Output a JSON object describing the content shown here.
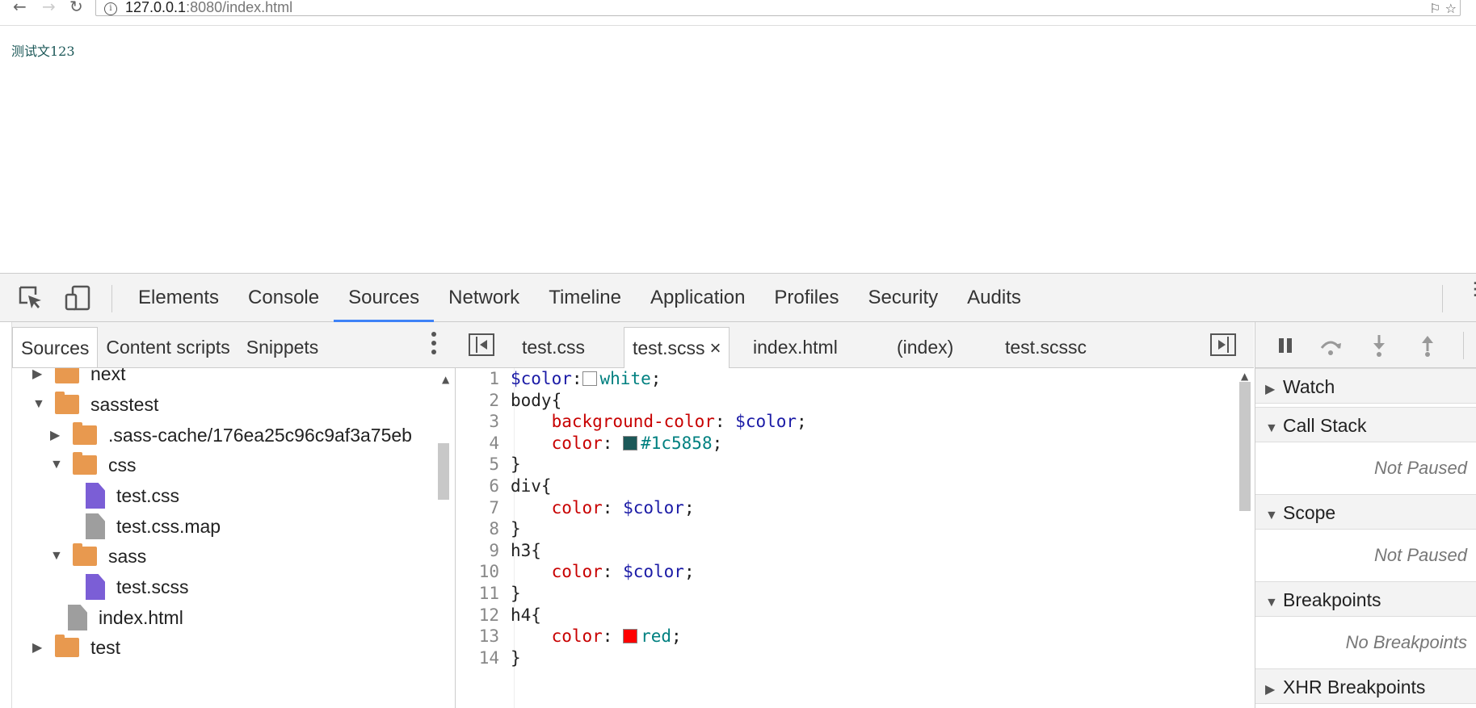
{
  "browser": {
    "url_host": "127.0.0.1",
    "url_rest": ":8080/index.html"
  },
  "page": {
    "text": "测试文123"
  },
  "devtools": {
    "main_tabs": [
      "Elements",
      "Console",
      "Sources",
      "Network",
      "Timeline",
      "Application",
      "Profiles",
      "Security",
      "Audits"
    ],
    "active_main_tab": "Sources",
    "navigator": {
      "tabs": [
        "Sources",
        "Content scripts",
        "Snippets"
      ],
      "active_tab": "Sources",
      "tree": [
        {
          "label": "next",
          "type": "folder",
          "expanded": false,
          "depth": 0
        },
        {
          "label": "sasstest",
          "type": "folder",
          "expanded": true,
          "depth": 0
        },
        {
          "label": ".sass-cache/176ea25c96c9af3a75eb",
          "type": "folder",
          "expanded": false,
          "depth": 1
        },
        {
          "label": "css",
          "type": "folder",
          "expanded": true,
          "depth": 1
        },
        {
          "label": "test.css",
          "type": "file-css",
          "depth": 2
        },
        {
          "label": "test.css.map",
          "type": "file",
          "depth": 2
        },
        {
          "label": "sass",
          "type": "folder",
          "expanded": true,
          "depth": 1
        },
        {
          "label": "test.scss",
          "type": "file-css",
          "depth": 2
        },
        {
          "label": "index.html",
          "type": "file",
          "depth": 1
        },
        {
          "label": "test",
          "type": "folder",
          "expanded": false,
          "depth": 0
        }
      ]
    },
    "editor": {
      "tabs": [
        "test.css",
        "test.scss",
        "index.html",
        "(index)",
        "test.scssc"
      ],
      "active_tab": "test.scss",
      "close_glyph": "×",
      "lines": [
        {
          "n": "1",
          "tokens": [
            [
              "var",
              "$color"
            ],
            [
              "plain",
              ":"
            ],
            [
              "swatch",
              "#ffffff"
            ],
            [
              "val",
              "white"
            ],
            [
              "plain",
              ";"
            ]
          ]
        },
        {
          "n": "2",
          "tokens": [
            [
              "plain",
              "body{"
            ]
          ]
        },
        {
          "n": "3",
          "tokens": [
            [
              "plain",
              "    "
            ],
            [
              "prop",
              "background-color"
            ],
            [
              "plain",
              ": "
            ],
            [
              "var",
              "$color"
            ],
            [
              "plain",
              ";"
            ]
          ]
        },
        {
          "n": "4",
          "tokens": [
            [
              "plain",
              "    "
            ],
            [
              "prop",
              "color"
            ],
            [
              "plain",
              ": "
            ],
            [
              "swatch",
              "#1c5858"
            ],
            [
              "val",
              "#1c5858"
            ],
            [
              "plain",
              ";"
            ]
          ]
        },
        {
          "n": "5",
          "tokens": [
            [
              "plain",
              "}"
            ]
          ]
        },
        {
          "n": "6",
          "tokens": [
            [
              "plain",
              "div{"
            ]
          ]
        },
        {
          "n": "7",
          "tokens": [
            [
              "plain",
              "    "
            ],
            [
              "prop",
              "color"
            ],
            [
              "plain",
              ": "
            ],
            [
              "var",
              "$color"
            ],
            [
              "plain",
              ";"
            ]
          ]
        },
        {
          "n": "8",
          "tokens": [
            [
              "plain",
              "}"
            ]
          ]
        },
        {
          "n": "9",
          "tokens": [
            [
              "plain",
              "h3{"
            ]
          ]
        },
        {
          "n": "10",
          "tokens": [
            [
              "plain",
              "    "
            ],
            [
              "prop",
              "color"
            ],
            [
              "plain",
              ": "
            ],
            [
              "var",
              "$color"
            ],
            [
              "plain",
              ";"
            ]
          ]
        },
        {
          "n": "11",
          "tokens": [
            [
              "plain",
              "}"
            ]
          ]
        },
        {
          "n": "12",
          "tokens": [
            [
              "plain",
              "h4{"
            ]
          ]
        },
        {
          "n": "13",
          "tokens": [
            [
              "plain",
              "    "
            ],
            [
              "prop",
              "color"
            ],
            [
              "plain",
              ": "
            ],
            [
              "swatch",
              "#ff0000"
            ],
            [
              "val",
              "red"
            ],
            [
              "plain",
              ";"
            ]
          ]
        },
        {
          "n": "14",
          "tokens": [
            [
              "plain",
              "}"
            ]
          ]
        }
      ]
    },
    "debugger": {
      "sections": [
        {
          "title": "Watch",
          "expanded": false,
          "body": ""
        },
        {
          "title": "Call Stack",
          "expanded": true,
          "body": "Not Paused"
        },
        {
          "title": "Scope",
          "expanded": true,
          "body": "Not Paused"
        },
        {
          "title": "Breakpoints",
          "expanded": true,
          "body": "No Breakpoints"
        },
        {
          "title": "XHR Breakpoints",
          "expanded": false,
          "body": ""
        }
      ]
    }
  },
  "colors": {
    "accent": "#3e82f7",
    "folder": "#e8994f",
    "css_file": "#7b5ed6"
  }
}
